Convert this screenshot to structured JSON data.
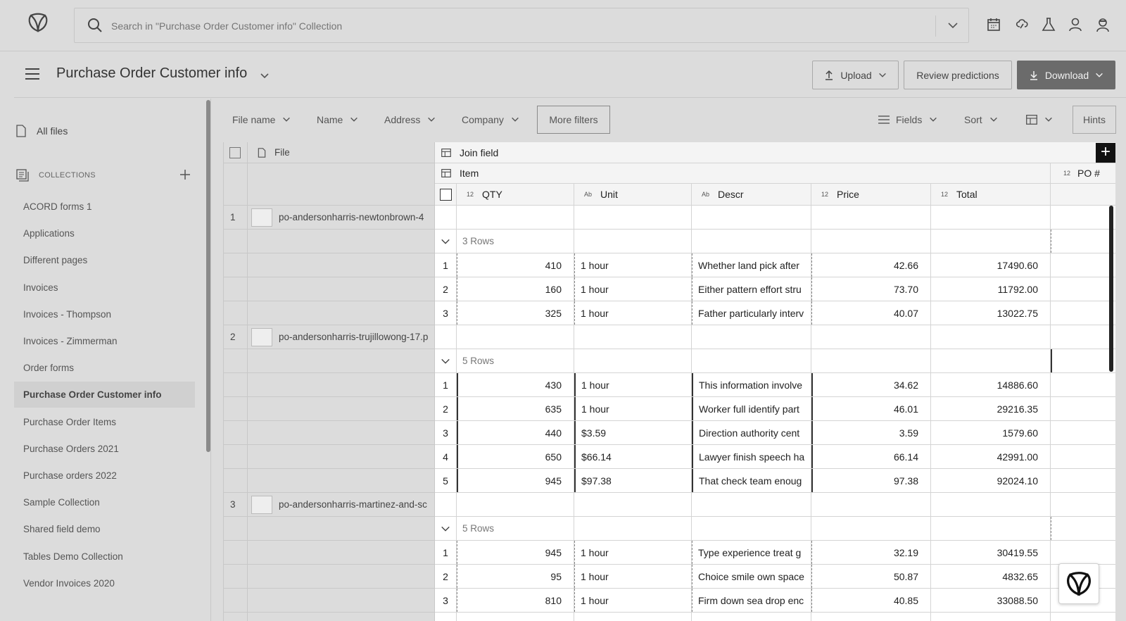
{
  "search": {
    "placeholder": "Search in \"Purchase Order Customer info\" Collection"
  },
  "header": {
    "title": "Purchase Order Customer info",
    "upload_label": "Upload",
    "review_label": "Review predictions",
    "download_label": "Download"
  },
  "sidebar": {
    "all_files": "All files",
    "collections_label": "COLLECTIONS",
    "collections": [
      "ACORD forms 1",
      "Applications",
      "Different pages",
      "Invoices",
      "Invoices - Thompson",
      "Invoices - Zimmerman",
      "Order forms",
      "Purchase Order Customer info",
      "Purchase Order Items",
      "Purchase Orders 2021",
      "Purchase orders 2022",
      "Sample Collection",
      "Shared field demo",
      "Tables Demo Collection",
      "Vendor Invoices 2020"
    ],
    "active_collection": "Purchase Order Customer info"
  },
  "filters": {
    "file_name": "File name",
    "name": "Name",
    "address": "Address",
    "company": "Company",
    "more_filters": "More filters",
    "fields": "Fields",
    "sort": "Sort",
    "hints": "Hints"
  },
  "table": {
    "file_header": "File",
    "join_field": "Join field",
    "item": "Item",
    "po_header": "PO #",
    "columns": [
      {
        "type": "12",
        "label": "QTY"
      },
      {
        "type": "Ab",
        "label": "Unit"
      },
      {
        "type": "Ab",
        "label": "Descr"
      },
      {
        "type": "12",
        "label": "Price"
      },
      {
        "type": "12",
        "label": "Total"
      }
    ],
    "files": [
      {
        "index": "1",
        "name": "po-andersonharris-newtonbrown-4",
        "rows_label": "3 Rows",
        "rows": [
          {
            "n": "1",
            "qty": "410",
            "unit": "1 hour",
            "descr": "Whether land pick after",
            "price": "42.66",
            "total": "17490.60"
          },
          {
            "n": "2",
            "qty": "160",
            "unit": "1 hour",
            "descr": "Either pattern effort stru",
            "price": "73.70",
            "total": "11792.00"
          },
          {
            "n": "3",
            "qty": "325",
            "unit": "1 hour",
            "descr": "Father particularly interv",
            "price": "40.07",
            "total": "13022.75"
          }
        ]
      },
      {
        "index": "2",
        "name": "po-andersonharris-trujillowong-17.p",
        "rows_label": "5 Rows",
        "rows": [
          {
            "n": "1",
            "qty": "430",
            "unit": "1 hour",
            "descr": "This information involve",
            "price": "34.62",
            "total": "14886.60"
          },
          {
            "n": "2",
            "qty": "635",
            "unit": "1 hour",
            "descr": "Worker full identify part",
            "price": "46.01",
            "total": "29216.35"
          },
          {
            "n": "3",
            "qty": "440",
            "unit": "$3.59",
            "descr": "Direction authority cent",
            "price": "3.59",
            "total": "1579.60"
          },
          {
            "n": "4",
            "qty": "650",
            "unit": "$66.14",
            "descr": "Lawyer finish speech ha",
            "price": "66.14",
            "total": "42991.00"
          },
          {
            "n": "5",
            "qty": "945",
            "unit": "$97.38",
            "descr": "That check team enoug",
            "price": "97.38",
            "total": "92024.10"
          }
        ]
      },
      {
        "index": "3",
        "name": "po-andersonharris-martinez-and-sc",
        "rows_label": "5 Rows",
        "rows": [
          {
            "n": "1",
            "qty": "945",
            "unit": "1 hour",
            "descr": "Type experience treat g",
            "price": "32.19",
            "total": "30419.55"
          },
          {
            "n": "2",
            "qty": "95",
            "unit": "1 hour",
            "descr": "Choice smile own space",
            "price": "50.87",
            "total": "4832.65"
          },
          {
            "n": "3",
            "qty": "810",
            "unit": "1 hour",
            "descr": "Firm down sea drop enc",
            "price": "40.85",
            "total": "33088.50"
          }
        ]
      }
    ]
  },
  "colors": {
    "background": "#dcdcdc",
    "panel": "#ffffff",
    "primary_button": "#6b6b6b"
  }
}
